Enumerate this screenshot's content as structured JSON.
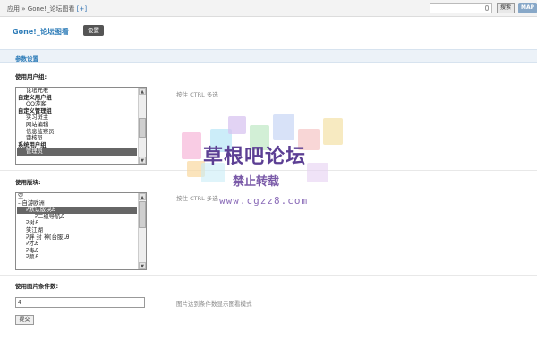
{
  "breadcrumb": {
    "app": "应用",
    "separator": "»",
    "current": "Gone!_论坛图看",
    "add": "[+]"
  },
  "toolbar": {
    "search_label": "搜索",
    "map_label": "MAP"
  },
  "page": {
    "title": "Gone!_论坛图看",
    "settings_button": "设置"
  },
  "section": {
    "title": "参数设置"
  },
  "user_groups": {
    "label": "使用用户组:",
    "hint": "按住 CTRL 多选",
    "options": [
      {
        "text": "论坛元老",
        "level": 1,
        "group": false,
        "selected": false
      },
      {
        "text": "自定义用户组",
        "level": 0,
        "group": true,
        "selected": false
      },
      {
        "text": "QQ游客",
        "level": 1,
        "group": false,
        "selected": false
      },
      {
        "text": "自定义管理组",
        "level": 0,
        "group": true,
        "selected": false
      },
      {
        "text": "实习斑主",
        "level": 1,
        "group": false,
        "selected": false
      },
      {
        "text": "网站编辑",
        "level": 1,
        "group": false,
        "selected": false
      },
      {
        "text": "信息监察员",
        "level": 1,
        "group": false,
        "selected": false
      },
      {
        "text": "审核员",
        "level": 1,
        "group": false,
        "selected": false
      },
      {
        "text": "系统用户组",
        "level": 0,
        "group": true,
        "selected": false
      },
      {
        "text": "管理员",
        "level": 1,
        "group": false,
        "selected": true
      }
    ]
  },
  "boards": {
    "label": "使用版块:",
    "hint": "按住 CTRL 多选",
    "options": [
      {
        "text": "空",
        "level": 0,
        "group": false,
        "selected": false
      },
      {
        "text": "--自游欧洲",
        "level": 0,
        "group": false,
        "selected": false
      },
      {
        "text": "Ꭾ默认版块Ꭿ",
        "level": 1,
        "group": false,
        "selected": true
      },
      {
        "text": "Ꭾ二级导航Ꭿ",
        "level": 2,
        "group": false,
        "selected": false
      },
      {
        "text": "Ꭾ树Ꭿ",
        "level": 1,
        "group": false,
        "selected": false
      },
      {
        "text": "笑江湖",
        "level": 1,
        "group": false,
        "selected": false
      },
      {
        "text": "Ꭾ胖 封 神[台服]Ꭿ",
        "level": 1,
        "group": false,
        "selected": false
      },
      {
        "text": "Ꭾ才Ꭿ",
        "level": 1,
        "group": false,
        "selected": false
      },
      {
        "text": "Ꭾ毒Ꭿ",
        "level": 1,
        "group": false,
        "selected": false
      },
      {
        "text": "Ꭾ颜Ꭿ",
        "level": 1,
        "group": false,
        "selected": false
      }
    ]
  },
  "image_condition": {
    "label": "使用图片条件数:",
    "value": "4",
    "hint": "图片达到条件数显示图看模式"
  },
  "submit_label": "提交",
  "watermark": {
    "line1": "草根吧论坛",
    "line2": "禁止转载",
    "line3": "www.cgzz8.com"
  },
  "colors": {
    "accent": "#2d7cb8",
    "section_bg": "#ecf2f8",
    "selected_bg": "#666666"
  }
}
